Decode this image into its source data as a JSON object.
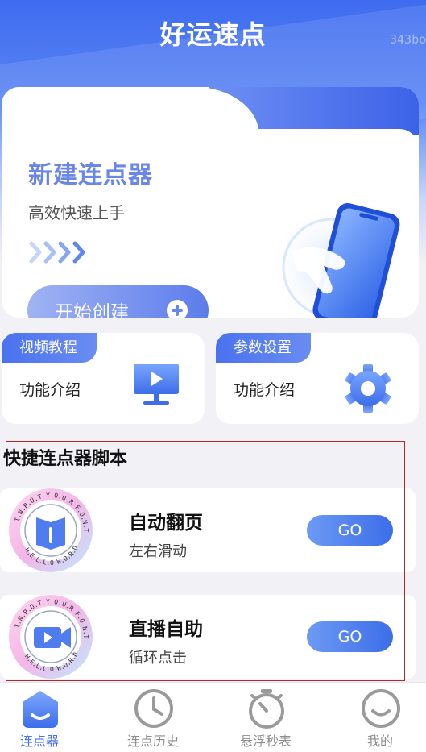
{
  "header": {
    "app_title": "好运速点",
    "watermark": "343bo"
  },
  "hero": {
    "title": "新建连点器",
    "subtitle": "高效快速上手",
    "start_label": "开始创建",
    "plus_icon": "plus-circle-icon"
  },
  "features": [
    {
      "tag": "视频教程",
      "desc": "功能介绍",
      "icon": "video-monitor-icon"
    },
    {
      "tag": "参数设置",
      "desc": "功能介绍",
      "icon": "gear-icon"
    }
  ],
  "scripts": {
    "section_title": "快捷连点器脚本",
    "badge_top_text": "I.N.P.U.T Y.O.U.R F.O.N.T",
    "badge_bottom_text": "H.E.L.L.O W.O.R.D",
    "items": [
      {
        "title": "自动翻页",
        "subtitle": "左右滑动",
        "go_label": "GO",
        "icon": "book-icon"
      },
      {
        "title": "直播自助",
        "subtitle": "循环点击",
        "go_label": "GO",
        "icon": "video-camera-icon"
      }
    ]
  },
  "tabbar": {
    "items": [
      {
        "label": "连点器",
        "icon": "home-smile-icon",
        "active": true
      },
      {
        "label": "连点历史",
        "icon": "clock-icon",
        "active": false
      },
      {
        "label": "悬浮秒表",
        "icon": "stopwatch-icon",
        "active": false
      },
      {
        "label": "我的",
        "icon": "smile-face-icon",
        "active": false
      }
    ]
  },
  "colors": {
    "primary": "#4a74ea",
    "hero_title": "#6a86e6",
    "highlight_border": "#b3262d"
  }
}
